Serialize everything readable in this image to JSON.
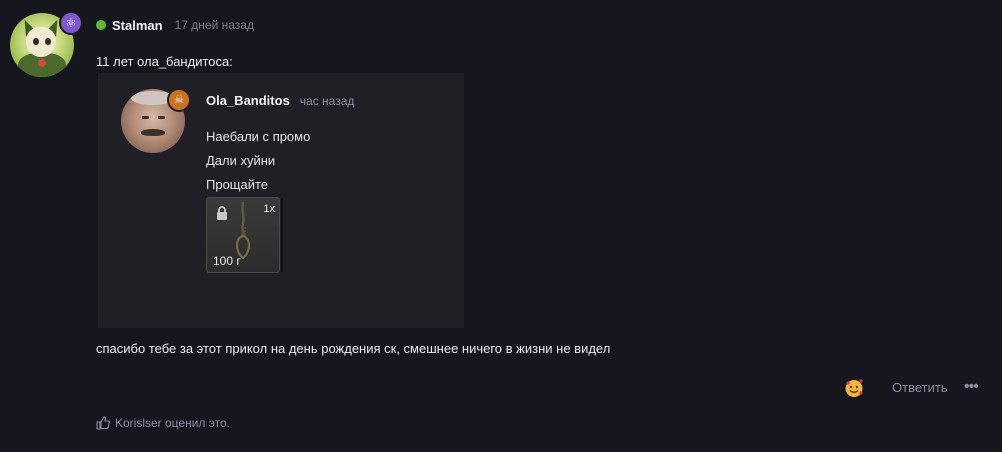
{
  "post": {
    "author": "Stalman",
    "time": "17 дней назад",
    "quote_intro": "11 лет ола_бандитоса:",
    "message": "спасибо тебе за этот прикол на день рождения ск, смешнее ничего в жизни не видел",
    "author_status_color": "#5fb93b",
    "author_badge_icon": "atom-icon",
    "author_badge_color": "#7f58c9"
  },
  "embed": {
    "author": "Ola_Banditos",
    "time": "час назад",
    "lines": [
      "Наебали с промо",
      "Дали хуйни",
      "Прощайте"
    ],
    "badge_icon": "skull-icon",
    "badge_color": "#c8731f",
    "item": {
      "qty": "1x",
      "price": "100 г",
      "icon": "noose-icon",
      "locked": true
    }
  },
  "actions": {
    "reaction_icon": "smiling-face-with-hearts-icon",
    "reply_label": "Ответить",
    "more_label": "•••"
  },
  "likes": {
    "text": "Korislser оценил это."
  }
}
